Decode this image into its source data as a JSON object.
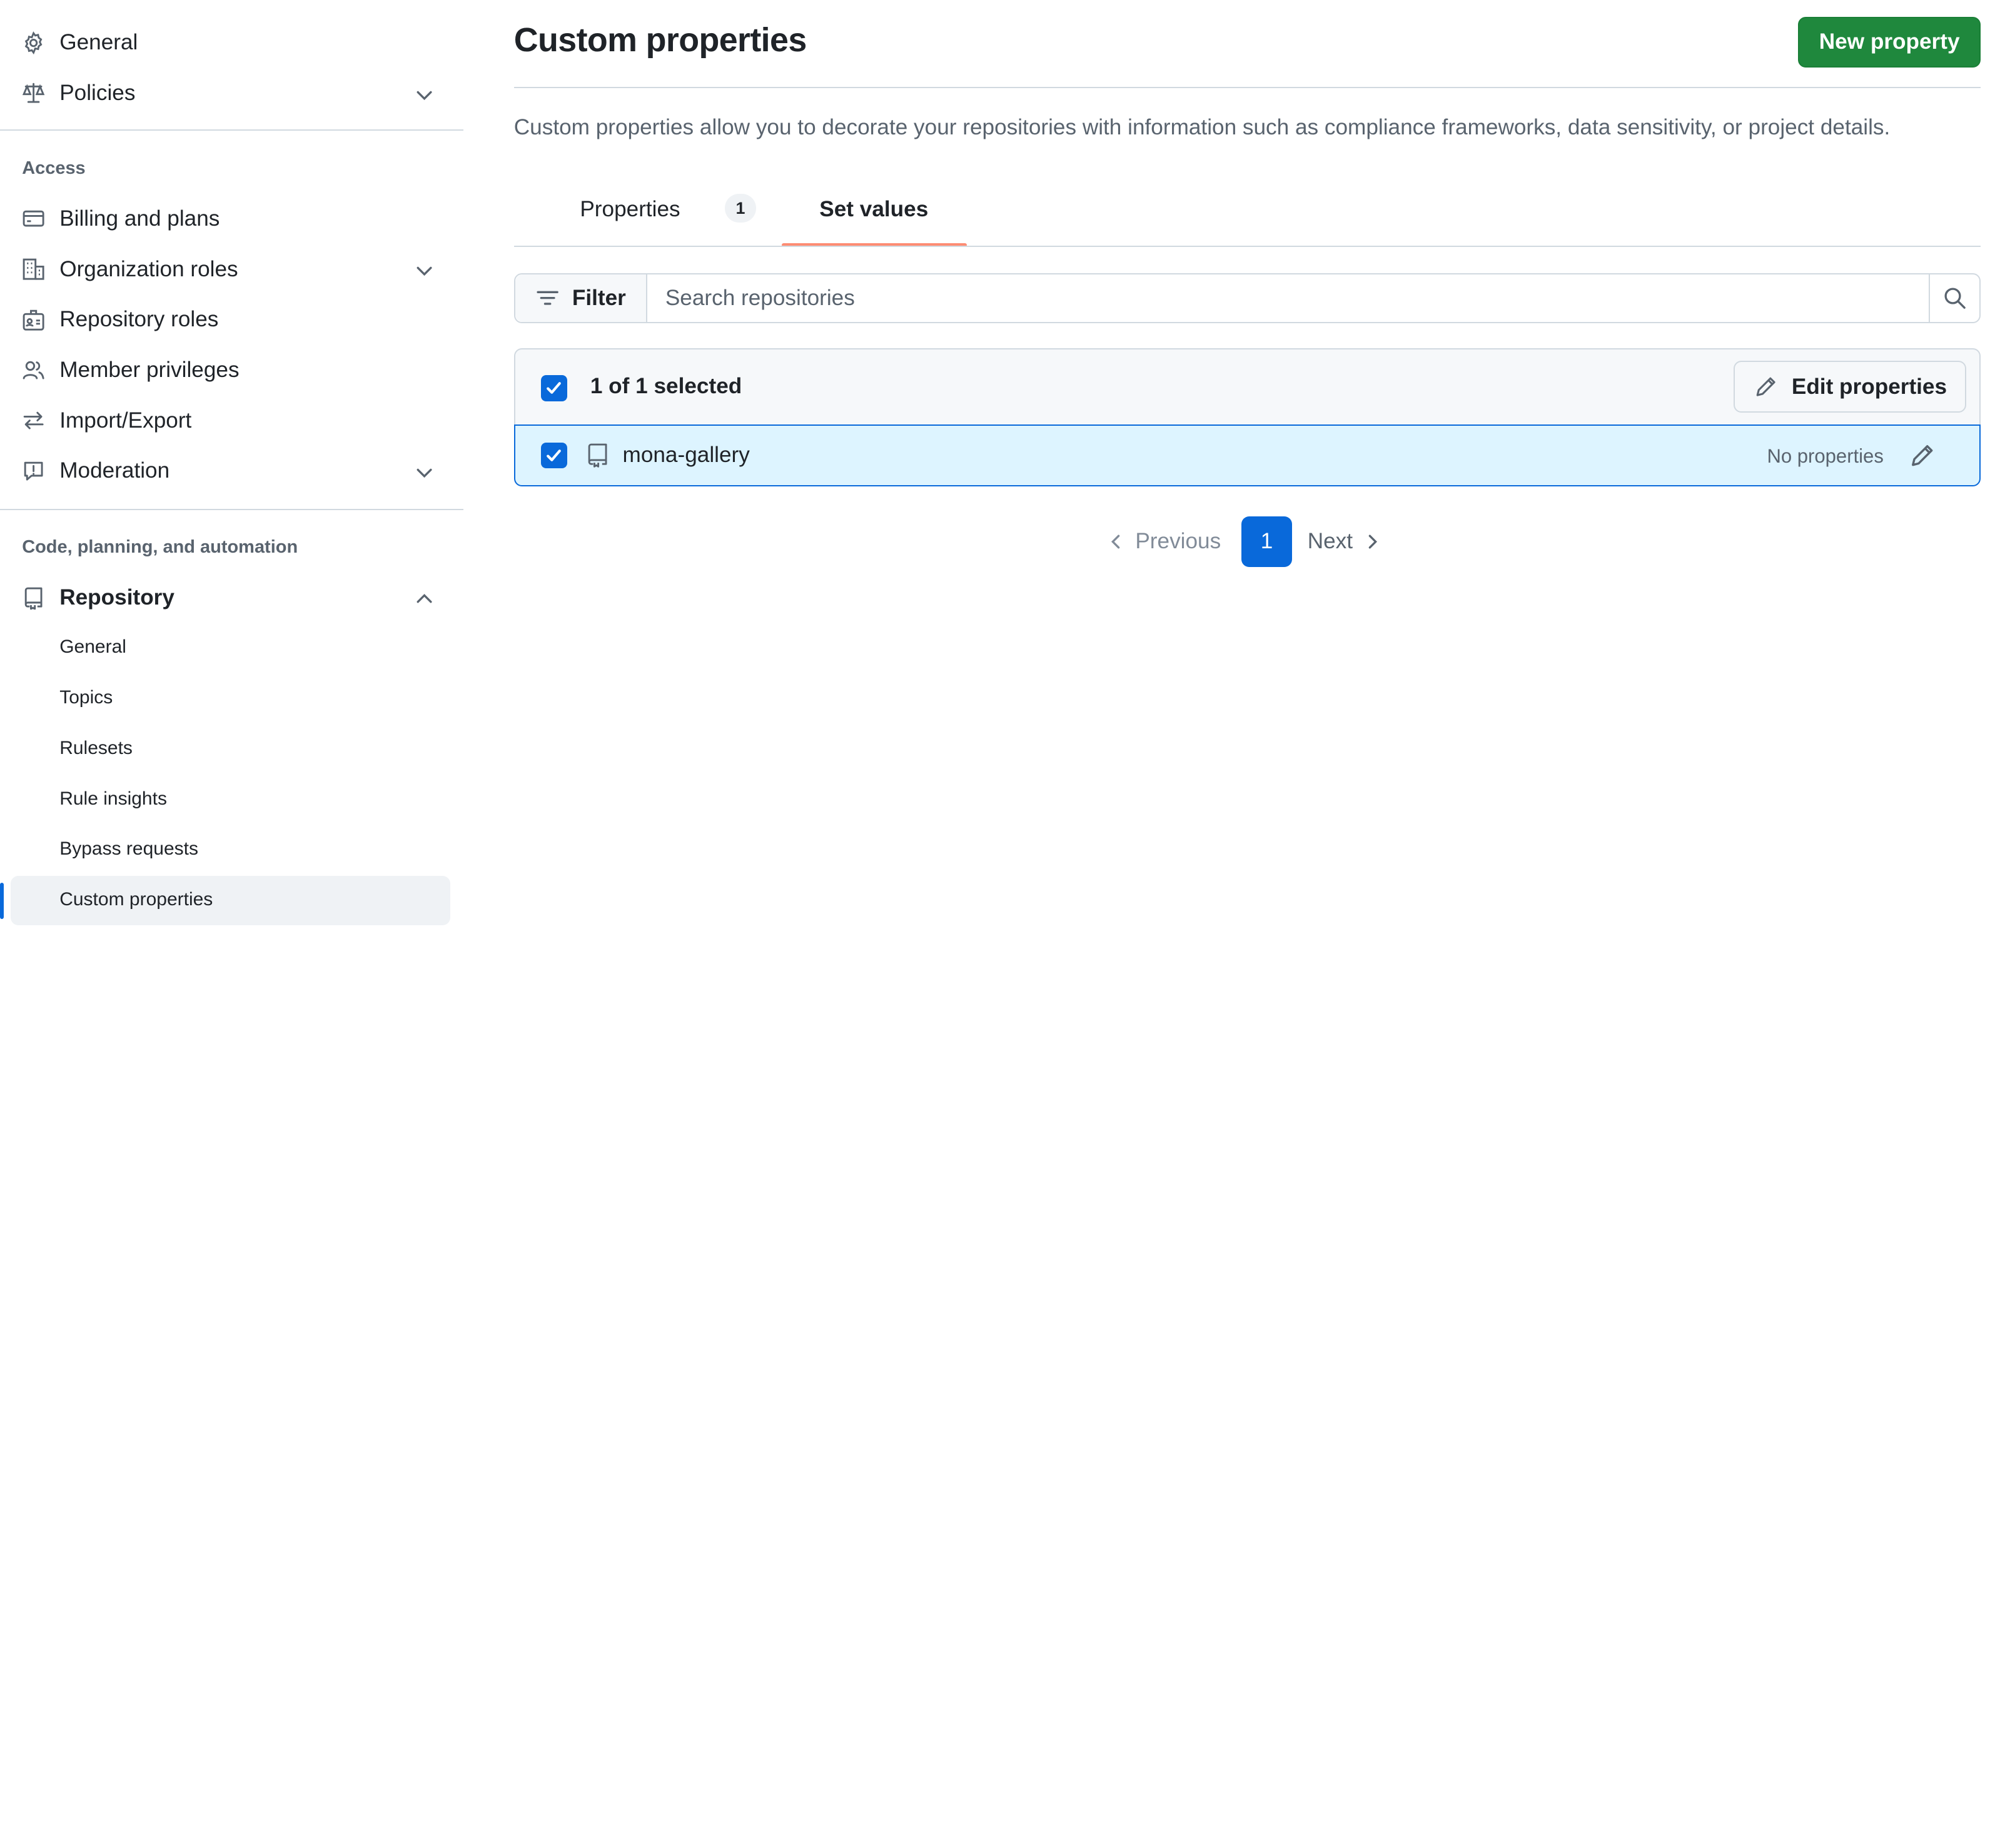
{
  "sidebar": {
    "top_items": [
      {
        "label": "General",
        "icon": "gear-icon"
      },
      {
        "label": "Policies",
        "icon": "law-icon"
      }
    ],
    "access": {
      "heading": "Access",
      "items": [
        {
          "label": "Billing and plans",
          "icon": "credit-card-icon"
        },
        {
          "label": "Organization roles",
          "icon": "organization-icon"
        },
        {
          "label": "Repository roles",
          "icon": "id-badge-icon"
        },
        {
          "label": "Member privileges",
          "icon": "people-icon"
        },
        {
          "label": "Import/Export",
          "icon": "arrow-switch-icon"
        },
        {
          "label": "Moderation",
          "icon": "report-icon"
        }
      ]
    },
    "code": {
      "heading": "Code, planning, and automation",
      "repository_label": "Repository",
      "sub_items": [
        "General",
        "Topics",
        "Rulesets",
        "Rule insights",
        "Bypass requests",
        "Custom properties"
      ],
      "active_sub_item": "Custom properties"
    }
  },
  "main": {
    "title": "Custom properties",
    "new_button": "New property",
    "description": "Custom properties allow you to decorate your repositories with information such as compliance frameworks, data sensitivity, or project details.",
    "tabs": [
      {
        "label": "Properties",
        "count": "1"
      },
      {
        "label": "Set values",
        "selected": true
      }
    ],
    "filter_label": "Filter",
    "search_placeholder": "Search repositories",
    "selection_text": "1 of 1 selected",
    "edit_button": "Edit properties",
    "repos": [
      {
        "name": "mona-gallery",
        "status": "No properties",
        "checked": true
      }
    ],
    "pagination": {
      "previous": "Previous",
      "current": "1",
      "next": "Next"
    }
  },
  "colors": {
    "accent": "#0969da",
    "primary_button": "#1f883d",
    "tab_underline": "#fd8c73",
    "selected_row": "#ddf4ff"
  }
}
